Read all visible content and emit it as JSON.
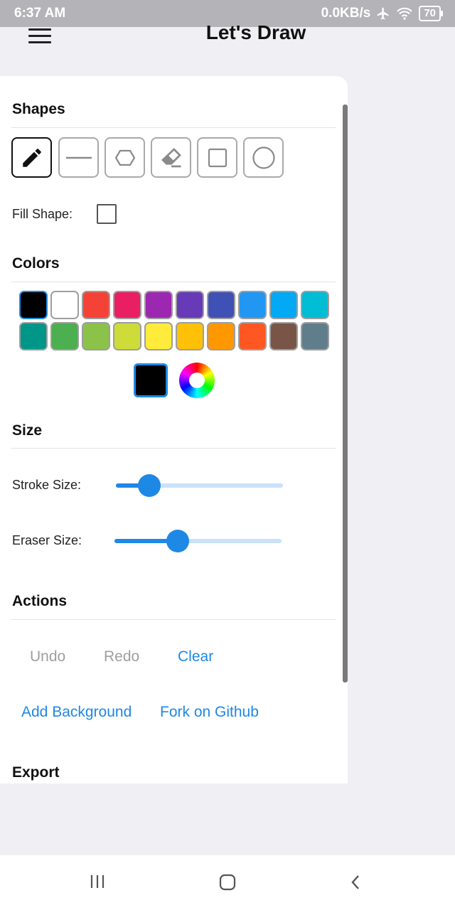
{
  "status_bar": {
    "time": "6:37 AM",
    "network_speed": "0.0KB/s",
    "battery": "70"
  },
  "app_bar": {
    "title": "Let's Draw",
    "menu_icon": "hamburger-menu-icon"
  },
  "drawer": {
    "shapes": {
      "title": "Shapes",
      "tools": [
        {
          "name": "pencil",
          "icon": "pencil-icon",
          "selected": true
        },
        {
          "name": "line",
          "icon": "line-icon",
          "selected": false
        },
        {
          "name": "hexagon",
          "icon": "hexagon-icon",
          "selected": false
        },
        {
          "name": "eraser",
          "icon": "eraser-icon",
          "selected": false
        },
        {
          "name": "square",
          "icon": "square-icon",
          "selected": false
        },
        {
          "name": "circle",
          "icon": "circle-icon",
          "selected": false
        }
      ],
      "fill_label": "Fill Shape:",
      "fill_checked": false
    },
    "colors": {
      "title": "Colors",
      "palette": [
        "#000000",
        "#ffffff",
        "#f44336",
        "#e91e63",
        "#9c27b0",
        "#673ab7",
        "#3f51b5",
        "#2196f3",
        "#03a9f4",
        "#00bcd4",
        "#009688",
        "#4caf50",
        "#8bc34a",
        "#cddc39",
        "#ffeb3b",
        "#ffc107",
        "#ff9800",
        "#ff5722",
        "#795548",
        "#607d8b"
      ],
      "selected_color": "#000000"
    },
    "size": {
      "title": "Size",
      "stroke_label": "Stroke Size:",
      "stroke_value": 0.2,
      "eraser_label": "Eraser Size:",
      "eraser_value": 0.38
    },
    "actions": {
      "title": "Actions",
      "undo": "Undo",
      "redo": "Redo",
      "clear": "Clear",
      "add_background": "Add Background",
      "fork": "Fork on Github"
    },
    "export": {
      "title": "Export"
    }
  },
  "nav_bar": {
    "recents_icon": "recents-icon",
    "home_icon": "home-icon",
    "back_icon": "back-icon"
  },
  "theme": {
    "accent": "#1e88e5",
    "disabled": "#9e9e9e"
  }
}
